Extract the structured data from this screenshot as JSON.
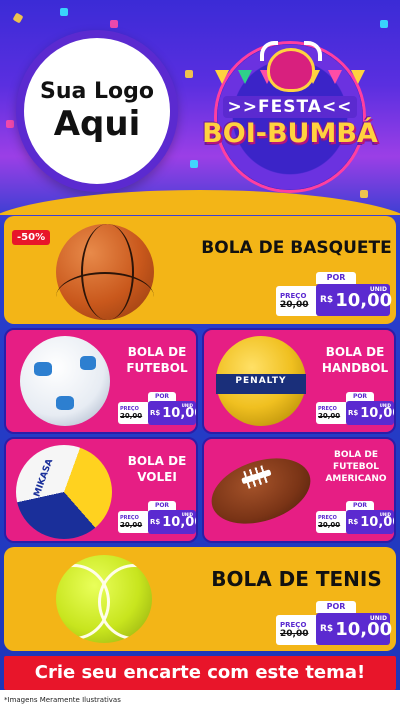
{
  "logo": {
    "line1": "Sua Logo",
    "line2": "Aqui"
  },
  "event": {
    "festa": ">>FESTA<<",
    "name": "BOI-BUMBÁ"
  },
  "labels": {
    "por": "POR",
    "preco": "PREÇO",
    "currency": "R$",
    "unid": "UNID"
  },
  "products": {
    "basquete": {
      "name": "BOLA DE BASQUETE",
      "discount": "-50%",
      "old_price": "20,00",
      "price": "10,00",
      "icon": "basketball-icon"
    },
    "futebol": {
      "name_l1": "BOLA DE",
      "name_l2": "FUTEBOL",
      "old_price": "20,00",
      "price": "10,00",
      "icon": "soccer-ball-icon"
    },
    "handbol": {
      "name_l1": "BOLA DE",
      "name_l2": "HANDBOL",
      "brand": "PENALTY",
      "old_price": "20,00",
      "price": "10,00",
      "icon": "handball-icon"
    },
    "volei": {
      "name_l1": "BOLA DE",
      "name_l2": "VOLEI",
      "brand": "MIKASA",
      "old_price": "20,00",
      "price": "10,00",
      "icon": "volleyball-icon"
    },
    "americano": {
      "name_l1": "BOLA DE",
      "name_l2": "FUTEBOL",
      "name_l3": "AMERICANO",
      "old_price": "20,00",
      "price": "10,00",
      "icon": "american-football-icon"
    },
    "tenis": {
      "name": "BOLA DE TENIS",
      "old_price": "20,00",
      "price": "10,00",
      "icon": "tennis-ball-icon"
    }
  },
  "cta": "Crie seu encarte com este tema!",
  "footer": "*Imagens Meramente Ilustrativas",
  "colors": {
    "yellow": "#f3b517",
    "pink": "#e61e84",
    "purple": "#5b2ad0",
    "red": "#e8152a"
  }
}
